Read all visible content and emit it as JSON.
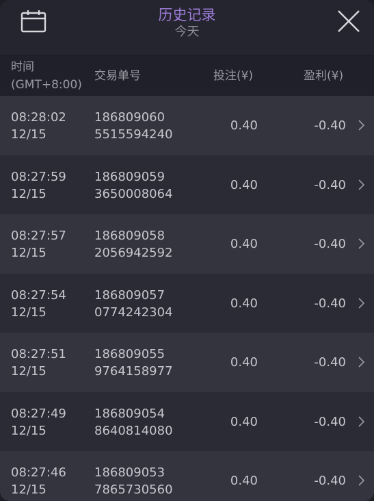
{
  "header": {
    "title": "历史记录",
    "subtitle": "今天",
    "calendar_icon": "calendar-icon",
    "close_icon": "close-icon"
  },
  "columns": {
    "time_line1": "时间",
    "time_line2": "(GMT+8:00)",
    "order": "交易单号",
    "bet": "投注(¥)",
    "profit": "盈利(¥)"
  },
  "rows": [
    {
      "time": "08:28:02",
      "date": "12/15",
      "order1": "186809060",
      "order2": "5515594240",
      "bet": "0.40",
      "profit": "-0.40"
    },
    {
      "time": "08:27:59",
      "date": "12/15",
      "order1": "186809059",
      "order2": "3650008064",
      "bet": "0.40",
      "profit": "-0.40"
    },
    {
      "time": "08:27:57",
      "date": "12/15",
      "order1": "186809058",
      "order2": "2056942592",
      "bet": "0.40",
      "profit": "-0.40"
    },
    {
      "time": "08:27:54",
      "date": "12/15",
      "order1": "186809057",
      "order2": "0774242304",
      "bet": "0.40",
      "profit": "-0.40"
    },
    {
      "time": "08:27:51",
      "date": "12/15",
      "order1": "186809055",
      "order2": "9764158977",
      "bet": "0.40",
      "profit": "-0.40"
    },
    {
      "time": "08:27:49",
      "date": "12/15",
      "order1": "186809054",
      "order2": "8640814080",
      "bet": "0.40",
      "profit": "-0.40"
    },
    {
      "time": "08:27:46",
      "date": "12/15",
      "order1": "186809053",
      "order2": "7865730560",
      "bet": "0.40",
      "profit": "-0.40"
    }
  ],
  "colors": {
    "accent": "#9d7cd8",
    "row_odd": "#34343f",
    "row_even": "#2b2b35"
  }
}
